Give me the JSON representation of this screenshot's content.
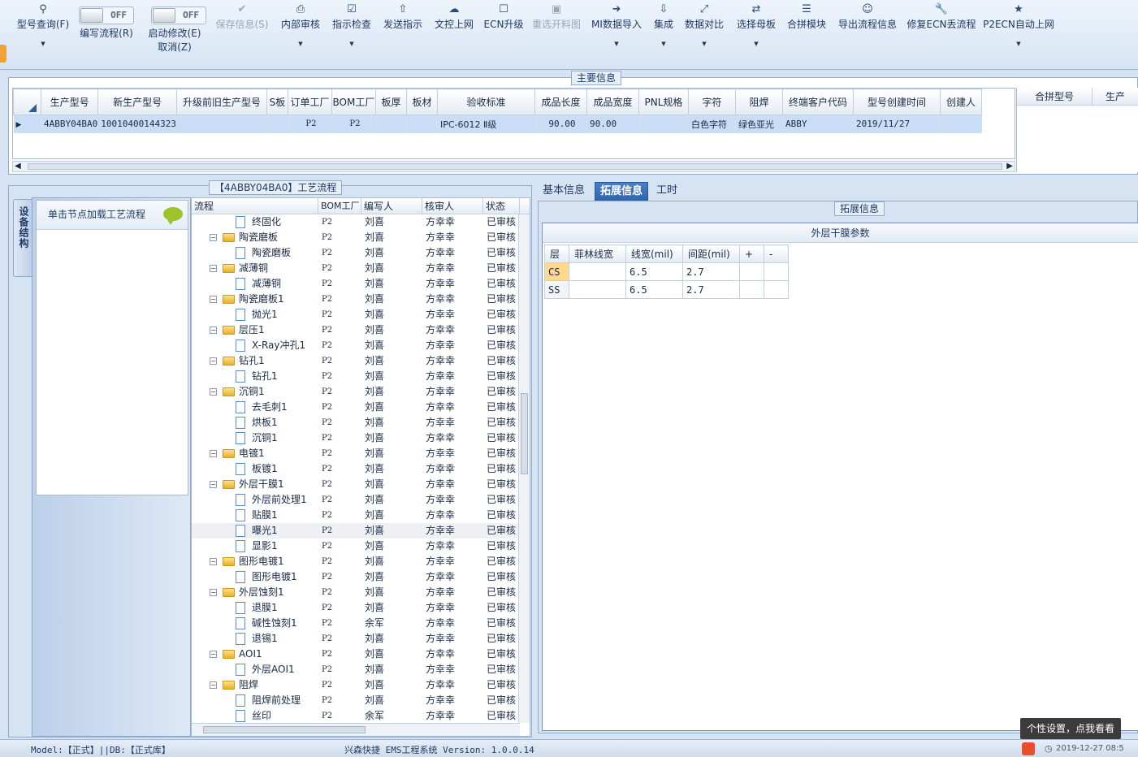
{
  "toolbar": {
    "model_query": "型号查询(F)",
    "edit_flow_label": "编写流程(R)",
    "start_modify_label": "启动修改(E)",
    "start_modify_cancel": "取消(Z)",
    "toggle_off": "OFF",
    "save_info": "保存信息(S)",
    "internal_review": "内部审核",
    "guide_check": "指示检查",
    "send_guide": "发送指示",
    "doc_upload": "文控上网",
    "ecn_upgrade": "ECN升级",
    "reselect_map": "重选开料图",
    "mi_import": "MI数据导入",
    "integrate": "集成",
    "data_compare": "数据对比",
    "select_mother_board": "选择母板",
    "merge_module": "合拼模块",
    "export_flow": "导出流程信息",
    "repair_ecn": "修复ECN丢流程",
    "p2ecn_upload": "P2ECN自动上网"
  },
  "main_info": {
    "legend": "主要信息",
    "columns": [
      "生产型号",
      "新生产型号",
      "升级前旧生产型号",
      "S板",
      "订单工厂",
      "BOM工厂",
      "板厚",
      "板材",
      "验收标准",
      "成品长度",
      "成品宽度",
      "PNL规格",
      "字符",
      "阻焊",
      "终端客户代码",
      "型号创建时间",
      "创建人"
    ],
    "row": [
      "4ABBY04BA0",
      "10010400144323",
      "",
      "",
      "P2",
      "P2",
      "",
      "",
      "IPC-6012 Ⅱ级",
      "90.00",
      "90.00",
      "",
      "白色字符",
      "绿色亚光",
      "ABBY",
      "2019/11/27",
      ""
    ],
    "right_columns": [
      "合拼型号",
      "生产"
    ]
  },
  "flow_panel": {
    "legend": "【4ABBY04BA0】工艺流程",
    "side_tab": "设备结构",
    "struct_hint": "单击节点加载工艺流程",
    "tree_columns": [
      "流程",
      "BOM工厂",
      "编写人",
      "核审人",
      "状态"
    ],
    "rows": [
      {
        "name": "终固化",
        "kind": "doc",
        "bom": "P2",
        "writer": "刘喜",
        "reviewer": "方幸幸",
        "status": "已审核"
      },
      {
        "name": "陶瓷磨板",
        "kind": "folder",
        "bom": "P2",
        "writer": "刘喜",
        "reviewer": "方幸幸",
        "status": "已审核"
      },
      {
        "name": "陶瓷磨板",
        "kind": "doc",
        "bom": "P2",
        "writer": "刘喜",
        "reviewer": "方幸幸",
        "status": "已审核"
      },
      {
        "name": "减薄铜",
        "kind": "folder",
        "bom": "P2",
        "writer": "刘喜",
        "reviewer": "方幸幸",
        "status": "已审核"
      },
      {
        "name": "减薄铜",
        "kind": "doc",
        "bom": "P2",
        "writer": "刘喜",
        "reviewer": "方幸幸",
        "status": "已审核"
      },
      {
        "name": "陶瓷磨板1",
        "kind": "folder",
        "bom": "P2",
        "writer": "刘喜",
        "reviewer": "方幸幸",
        "status": "已审核"
      },
      {
        "name": "抛光1",
        "kind": "doc",
        "bom": "P2",
        "writer": "刘喜",
        "reviewer": "方幸幸",
        "status": "已审核"
      },
      {
        "name": "层压1",
        "kind": "folder",
        "bom": "P2",
        "writer": "刘喜",
        "reviewer": "方幸幸",
        "status": "已审核"
      },
      {
        "name": "X-Ray冲孔1",
        "kind": "doc",
        "bom": "P2",
        "writer": "刘喜",
        "reviewer": "方幸幸",
        "status": "已审核"
      },
      {
        "name": "钻孔1",
        "kind": "folder",
        "bom": "P2",
        "writer": "刘喜",
        "reviewer": "方幸幸",
        "status": "已审核"
      },
      {
        "name": "钻孔1",
        "kind": "doc",
        "bom": "P2",
        "writer": "刘喜",
        "reviewer": "方幸幸",
        "status": "已审核"
      },
      {
        "name": "沉铜1",
        "kind": "folder",
        "bom": "P2",
        "writer": "刘喜",
        "reviewer": "方幸幸",
        "status": "已审核"
      },
      {
        "name": "去毛刺1",
        "kind": "doc",
        "bom": "P2",
        "writer": "刘喜",
        "reviewer": "方幸幸",
        "status": "已审核"
      },
      {
        "name": "烘板1",
        "kind": "doc",
        "bom": "P2",
        "writer": "刘喜",
        "reviewer": "方幸幸",
        "status": "已审核"
      },
      {
        "name": "沉铜1",
        "kind": "doc",
        "bom": "P2",
        "writer": "刘喜",
        "reviewer": "方幸幸",
        "status": "已审核"
      },
      {
        "name": "电镀1",
        "kind": "folder",
        "bom": "P2",
        "writer": "刘喜",
        "reviewer": "方幸幸",
        "status": "已审核"
      },
      {
        "name": "板镀1",
        "kind": "doc",
        "bom": "P2",
        "writer": "刘喜",
        "reviewer": "方幸幸",
        "status": "已审核"
      },
      {
        "name": "外层干膜1",
        "kind": "folder",
        "bom": "P2",
        "writer": "刘喜",
        "reviewer": "方幸幸",
        "status": "已审核"
      },
      {
        "name": "外层前处理1",
        "kind": "doc",
        "bom": "P2",
        "writer": "刘喜",
        "reviewer": "方幸幸",
        "status": "已审核"
      },
      {
        "name": "贴膜1",
        "kind": "doc",
        "bom": "P2",
        "writer": "刘喜",
        "reviewer": "方幸幸",
        "status": "已审核"
      },
      {
        "name": "曝光1",
        "kind": "doc",
        "bom": "P2",
        "writer": "刘喜",
        "reviewer": "方幸幸",
        "status": "已审核",
        "selected": true
      },
      {
        "name": "显影1",
        "kind": "doc",
        "bom": "P2",
        "writer": "刘喜",
        "reviewer": "方幸幸",
        "status": "已审核"
      },
      {
        "name": "图形电镀1",
        "kind": "folder",
        "bom": "P2",
        "writer": "刘喜",
        "reviewer": "方幸幸",
        "status": "已审核"
      },
      {
        "name": "图形电镀1",
        "kind": "doc",
        "bom": "P2",
        "writer": "刘喜",
        "reviewer": "方幸幸",
        "status": "已审核"
      },
      {
        "name": "外层蚀刻1",
        "kind": "folder",
        "bom": "P2",
        "writer": "刘喜",
        "reviewer": "方幸幸",
        "status": "已审核"
      },
      {
        "name": "退膜1",
        "kind": "doc",
        "bom": "P2",
        "writer": "刘喜",
        "reviewer": "方幸幸",
        "status": "已审核"
      },
      {
        "name": "碱性蚀刻1",
        "kind": "doc",
        "bom": "P2",
        "writer": "余军",
        "reviewer": "方幸幸",
        "status": "已审核"
      },
      {
        "name": "退锡1",
        "kind": "doc",
        "bom": "P2",
        "writer": "刘喜",
        "reviewer": "方幸幸",
        "status": "已审核"
      },
      {
        "name": "AOI1",
        "kind": "folder",
        "bom": "P2",
        "writer": "刘喜",
        "reviewer": "方幸幸",
        "status": "已审核"
      },
      {
        "name": "外层AOI1",
        "kind": "doc",
        "bom": "P2",
        "writer": "刘喜",
        "reviewer": "方幸幸",
        "status": "已审核"
      },
      {
        "name": "阻焊",
        "kind": "folder",
        "bom": "P2",
        "writer": "刘喜",
        "reviewer": "方幸幸",
        "status": "已审核"
      },
      {
        "name": "阻焊前处理",
        "kind": "doc",
        "bom": "P2",
        "writer": "刘喜",
        "reviewer": "方幸幸",
        "status": "已审核"
      },
      {
        "name": "丝印",
        "kind": "doc",
        "bom": "P2",
        "writer": "余军",
        "reviewer": "方幸幸",
        "status": "已审核"
      }
    ]
  },
  "detail": {
    "tabs": [
      "基本信息",
      "拓展信息",
      "工时"
    ],
    "legend": "拓展信息",
    "title": "外层干膜参数",
    "columns": [
      "层",
      "菲林线宽",
      "线宽(mil)",
      "间距(mil)",
      "+",
      "-"
    ],
    "rows": [
      [
        "CS",
        "",
        "6.5",
        "2.7",
        "",
        ""
      ],
      [
        "SS",
        "",
        "6.5",
        "2.7",
        "",
        ""
      ]
    ]
  },
  "status": {
    "model": "Model:【正式】||DB:【正式库】",
    "system": "兴森快捷 EMS工程系统 Version: 1.0.0.14",
    "tooltip": "个性设置，点我看看",
    "clock": "2019-12-27 08:5"
  }
}
